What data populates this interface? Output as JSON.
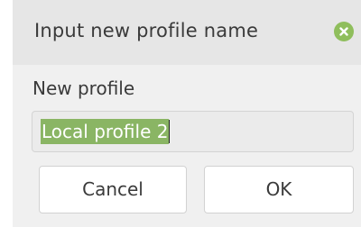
{
  "dialog": {
    "title": "Input new profile name",
    "close_icon": "close-icon",
    "field_label": "New profile",
    "input_value": "Local profile 2",
    "cancel_label": "Cancel",
    "ok_label": "OK"
  },
  "colors": {
    "accent": "#8fbe5c",
    "selection": "#8ab564",
    "background": "#f0f0f0",
    "titlebar": "#e6e6e6"
  }
}
